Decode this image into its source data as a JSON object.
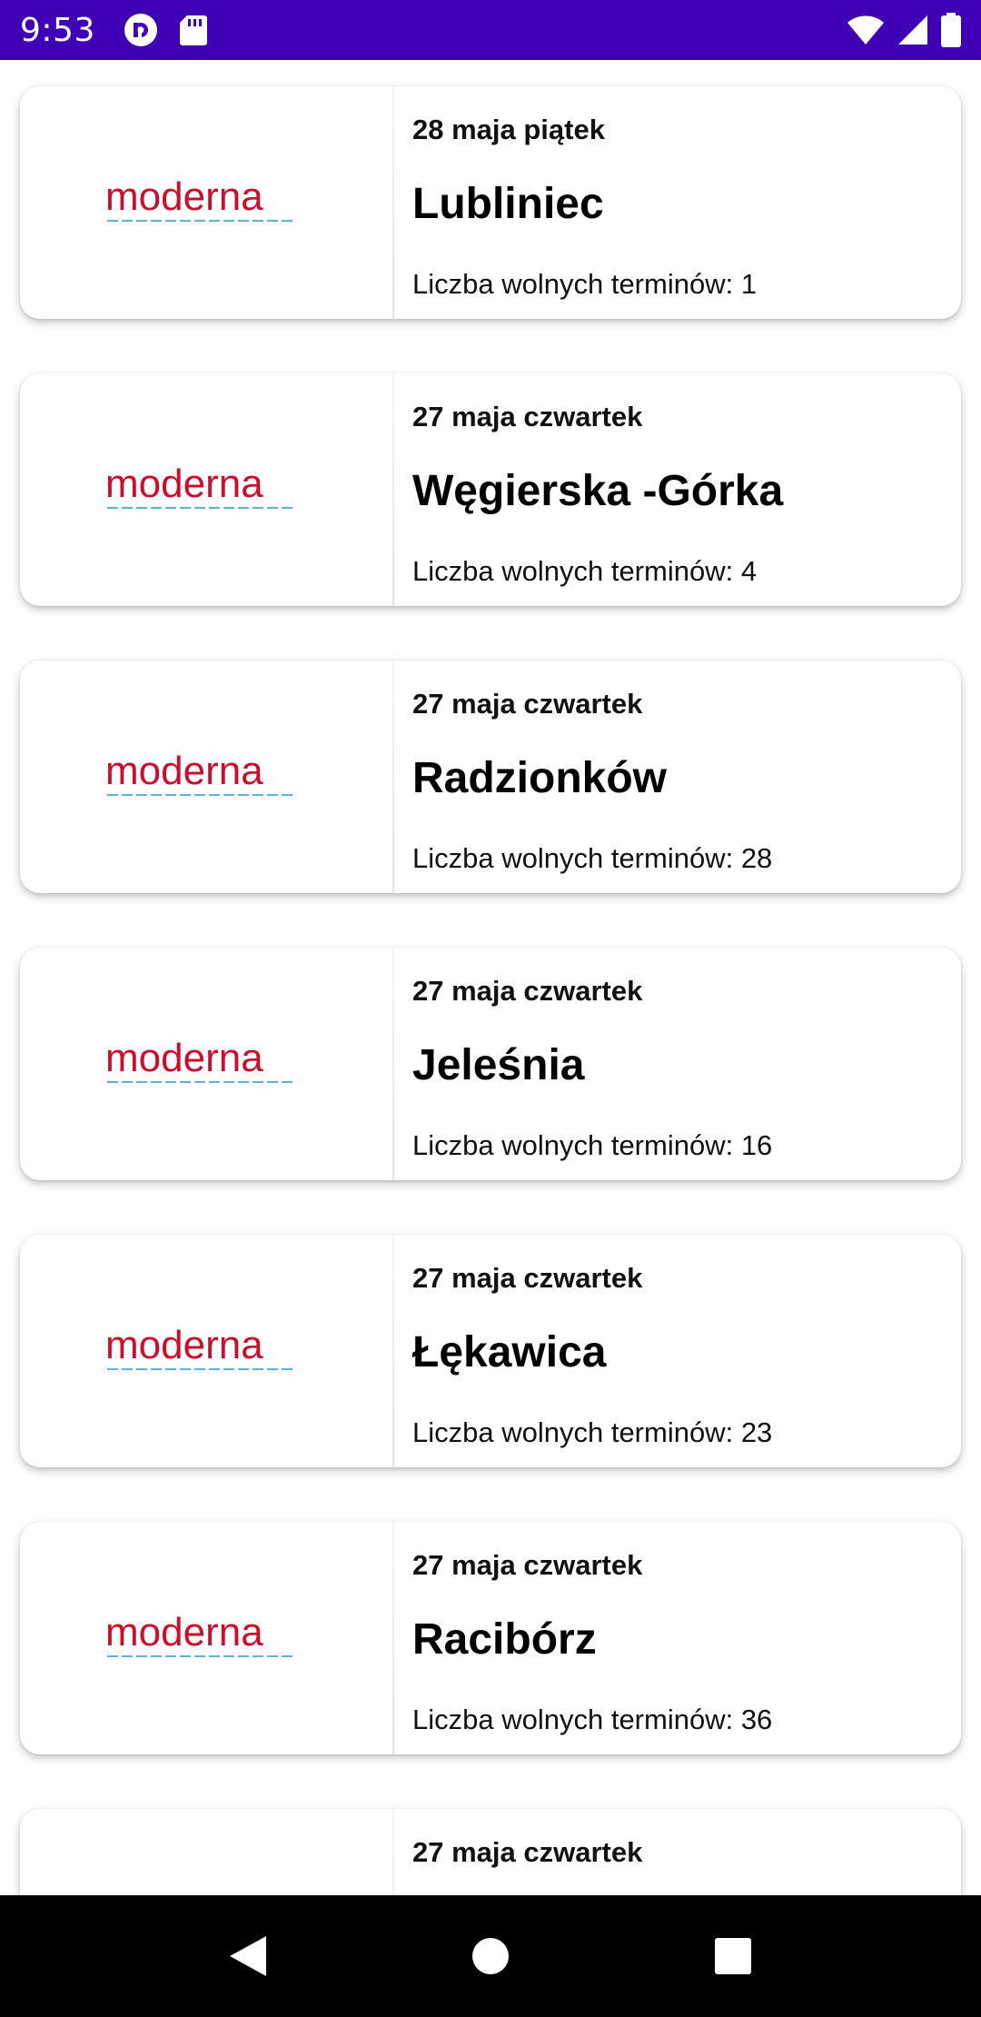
{
  "status_bar": {
    "time": "9:53",
    "background": "#3F00B5",
    "icons_left": [
      "pocket-casts-icon",
      "sd-card-icon"
    ],
    "icons_right": [
      "wifi-icon",
      "cellular-signal-icon",
      "battery-icon"
    ]
  },
  "list": {
    "logo_text": "moderna",
    "brand_colors": {
      "logo_red": "#C8102E",
      "logo_blue": "#5BB3D8"
    },
    "items": [
      {
        "date": "28 maja piątek",
        "city": "Lubliniec",
        "slots": "Liczba wolnych terminów: 1"
      },
      {
        "date": "27 maja czwartek",
        "city": "Węgierska -Górka",
        "slots": "Liczba wolnych terminów: 4"
      },
      {
        "date": "27 maja czwartek",
        "city": "Radzionków",
        "slots": "Liczba wolnych terminów: 28"
      },
      {
        "date": "27 maja czwartek",
        "city": "Jeleśnia",
        "slots": "Liczba wolnych terminów: 16"
      },
      {
        "date": "27 maja czwartek",
        "city": "Łękawica",
        "slots": "Liczba wolnych terminów: 23"
      },
      {
        "date": "27 maja czwartek",
        "city": "Racibórz",
        "slots": "Liczba wolnych terminów: 36"
      },
      {
        "date": "27 maja czwartek",
        "city": "",
        "slots": ""
      }
    ]
  },
  "nav_bar": {
    "buttons": [
      "back-icon",
      "home-icon",
      "recents-icon"
    ]
  }
}
